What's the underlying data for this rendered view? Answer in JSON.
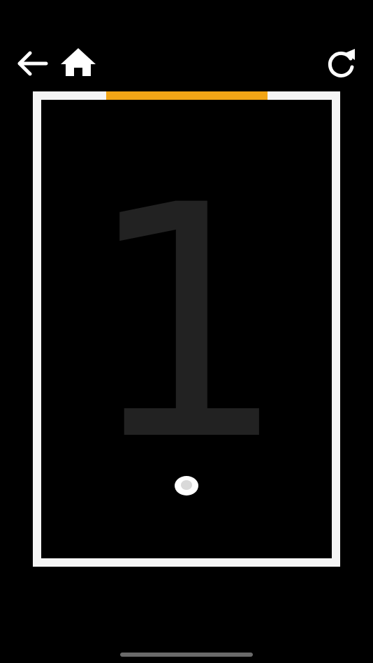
{
  "game": {
    "score": "1",
    "colors": {
      "background": "#000000",
      "wall": "#f5f5f5",
      "goal": "#f2a516",
      "score_digit": "#222222",
      "ball": "#ffffff"
    }
  },
  "toolbar": {
    "back_icon": "arrow-left-icon",
    "home_icon": "home-icon",
    "restart_icon": "refresh-icon"
  }
}
